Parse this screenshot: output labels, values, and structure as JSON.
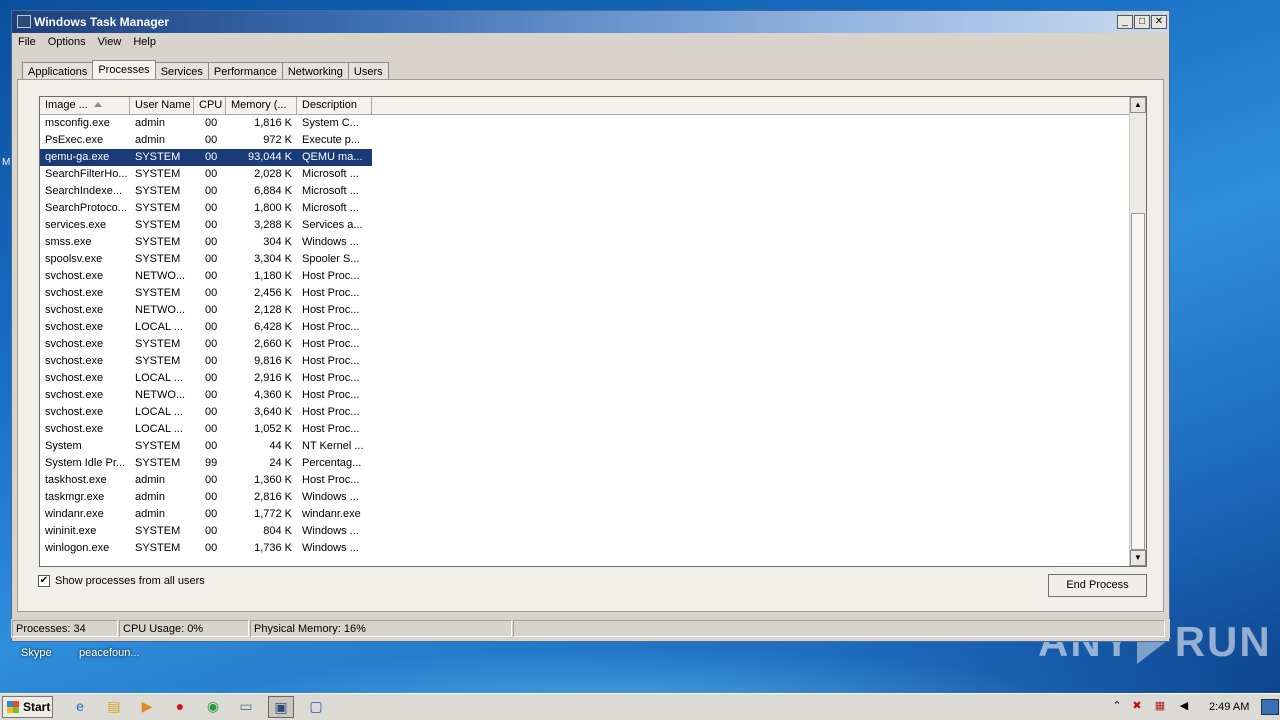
{
  "window": {
    "title": "Windows Task Manager",
    "controls": {
      "minimize": "_",
      "maximize": "□",
      "close": "✕"
    }
  },
  "menu": [
    "File",
    "Options",
    "View",
    "Help"
  ],
  "tabs": [
    "Applications",
    "Processes",
    "Services",
    "Performance",
    "Networking",
    "Users"
  ],
  "active_tab": "Processes",
  "columns": [
    "Image ...",
    "User Name",
    "CPU",
    "Memory (...",
    "Description"
  ],
  "processes": [
    {
      "image": "msconfig.exe",
      "user": "admin",
      "cpu": "00",
      "memory": "1,816 K",
      "description": "System C..."
    },
    {
      "image": "PsExec.exe",
      "user": "admin",
      "cpu": "00",
      "memory": "972 K",
      "description": "Execute p..."
    },
    {
      "image": "qemu-ga.exe",
      "user": "SYSTEM",
      "cpu": "00",
      "memory": "93,044 K",
      "description": "QEMU ma..."
    },
    {
      "image": "SearchFilterHo...",
      "user": "SYSTEM",
      "cpu": "00",
      "memory": "2,028 K",
      "description": "Microsoft ..."
    },
    {
      "image": "SearchIndexe...",
      "user": "SYSTEM",
      "cpu": "00",
      "memory": "6,884 K",
      "description": "Microsoft ..."
    },
    {
      "image": "SearchProtoco...",
      "user": "SYSTEM",
      "cpu": "00",
      "memory": "1,800 K",
      "description": "Microsoft ..."
    },
    {
      "image": "services.exe",
      "user": "SYSTEM",
      "cpu": "00",
      "memory": "3,288 K",
      "description": "Services a..."
    },
    {
      "image": "smss.exe",
      "user": "SYSTEM",
      "cpu": "00",
      "memory": "304 K",
      "description": "Windows ..."
    },
    {
      "image": "spoolsv.exe",
      "user": "SYSTEM",
      "cpu": "00",
      "memory": "3,304 K",
      "description": "Spooler S..."
    },
    {
      "image": "svchost.exe",
      "user": "NETWO...",
      "cpu": "00",
      "memory": "1,180 K",
      "description": "Host Proc..."
    },
    {
      "image": "svchost.exe",
      "user": "SYSTEM",
      "cpu": "00",
      "memory": "2,456 K",
      "description": "Host Proc..."
    },
    {
      "image": "svchost.exe",
      "user": "NETWO...",
      "cpu": "00",
      "memory": "2,128 K",
      "description": "Host Proc..."
    },
    {
      "image": "svchost.exe",
      "user": "LOCAL ...",
      "cpu": "00",
      "memory": "6,428 K",
      "description": "Host Proc..."
    },
    {
      "image": "svchost.exe",
      "user": "SYSTEM",
      "cpu": "00",
      "memory": "2,660 K",
      "description": "Host Proc..."
    },
    {
      "image": "svchost.exe",
      "user": "SYSTEM",
      "cpu": "00",
      "memory": "9,816 K",
      "description": "Host Proc..."
    },
    {
      "image": "svchost.exe",
      "user": "LOCAL ...",
      "cpu": "00",
      "memory": "2,916 K",
      "description": "Host Proc..."
    },
    {
      "image": "svchost.exe",
      "user": "NETWO...",
      "cpu": "00",
      "memory": "4,360 K",
      "description": "Host Proc..."
    },
    {
      "image": "svchost.exe",
      "user": "LOCAL ...",
      "cpu": "00",
      "memory": "3,640 K",
      "description": "Host Proc..."
    },
    {
      "image": "svchost.exe",
      "user": "LOCAL ...",
      "cpu": "00",
      "memory": "1,052 K",
      "description": "Host Proc..."
    },
    {
      "image": "System",
      "user": "SYSTEM",
      "cpu": "00",
      "memory": "44 K",
      "description": "NT Kernel ..."
    },
    {
      "image": "System Idle Pr...",
      "user": "SYSTEM",
      "cpu": "99",
      "memory": "24 K",
      "description": "Percentag..."
    },
    {
      "image": "taskhost.exe",
      "user": "admin",
      "cpu": "00",
      "memory": "1,360 K",
      "description": "Host Proc..."
    },
    {
      "image": "taskmgr.exe",
      "user": "admin",
      "cpu": "00",
      "memory": "2,816 K",
      "description": "Windows ..."
    },
    {
      "image": "windanr.exe",
      "user": "admin",
      "cpu": "00",
      "memory": "1,772 K",
      "description": "windanr.exe"
    },
    {
      "image": "wininit.exe",
      "user": "SYSTEM",
      "cpu": "00",
      "memory": "804 K",
      "description": "Windows ..."
    },
    {
      "image": "winlogon.exe",
      "user": "SYSTEM",
      "cpu": "00",
      "memory": "1,736 K",
      "description": "Windows ..."
    }
  ],
  "selected_image": "qemu-ga.exe",
  "show_all_users": {
    "label": "Show processes from all users",
    "checked": true,
    "mark": "✔"
  },
  "end_process_label": "End Process",
  "status": {
    "processes": "Processes: 34",
    "cpu_usage": "CPU Usage: 0%",
    "physical_memory": "Physical Memory: 16%"
  },
  "desktop": {
    "icons": [
      "Skype",
      "peacefoun..."
    ],
    "left_edge_letter": "M",
    "watermark_left": "ANY",
    "watermark_right": "RUN"
  },
  "taskbar": {
    "start_label": "Start",
    "items": [
      "ie-icon",
      "folder-icon",
      "media-player-icon",
      "opera-icon",
      "chrome-icon",
      "window-icon",
      "task-manager-icon",
      "remote-icon"
    ],
    "clock": "2:49 AM"
  }
}
